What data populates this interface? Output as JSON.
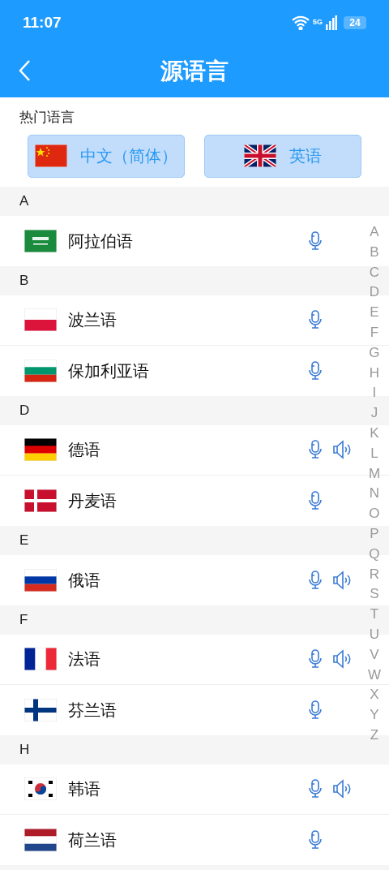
{
  "status_bar": {
    "time": "11:07",
    "network": "5G",
    "battery": "24"
  },
  "header": {
    "title": "源语言"
  },
  "hot": {
    "label": "热门语言",
    "items": [
      {
        "kind": "cn",
        "label": "中文（简体）"
      },
      {
        "kind": "gb",
        "label": "英语"
      }
    ]
  },
  "sections": [
    {
      "letter": "A",
      "items": [
        {
          "kind": "sa",
          "name": "阿拉伯语",
          "speaker": false
        }
      ]
    },
    {
      "letter": "B",
      "items": [
        {
          "kind": "pl",
          "name": "波兰语",
          "speaker": false
        },
        {
          "kind": "bg",
          "name": "保加利亚语",
          "speaker": false
        }
      ]
    },
    {
      "letter": "D",
      "items": [
        {
          "kind": "de",
          "name": "德语",
          "speaker": true
        },
        {
          "kind": "dk",
          "name": "丹麦语",
          "speaker": false
        }
      ]
    },
    {
      "letter": "E",
      "items": [
        {
          "kind": "ru",
          "name": "俄语",
          "speaker": true
        }
      ]
    },
    {
      "letter": "F",
      "items": [
        {
          "kind": "fr",
          "name": "法语",
          "speaker": true
        },
        {
          "kind": "fi",
          "name": "芬兰语",
          "speaker": false
        }
      ]
    },
    {
      "letter": "H",
      "items": [
        {
          "kind": "kr",
          "name": "韩语",
          "speaker": true
        },
        {
          "kind": "nl",
          "name": "荷兰语",
          "speaker": false
        }
      ]
    }
  ],
  "index": [
    "A",
    "B",
    "C",
    "D",
    "E",
    "F",
    "G",
    "H",
    "I",
    "J",
    "K",
    "L",
    "M",
    "N",
    "O",
    "P",
    "Q",
    "R",
    "S",
    "T",
    "U",
    "V",
    "W",
    "X",
    "Y",
    "Z"
  ]
}
